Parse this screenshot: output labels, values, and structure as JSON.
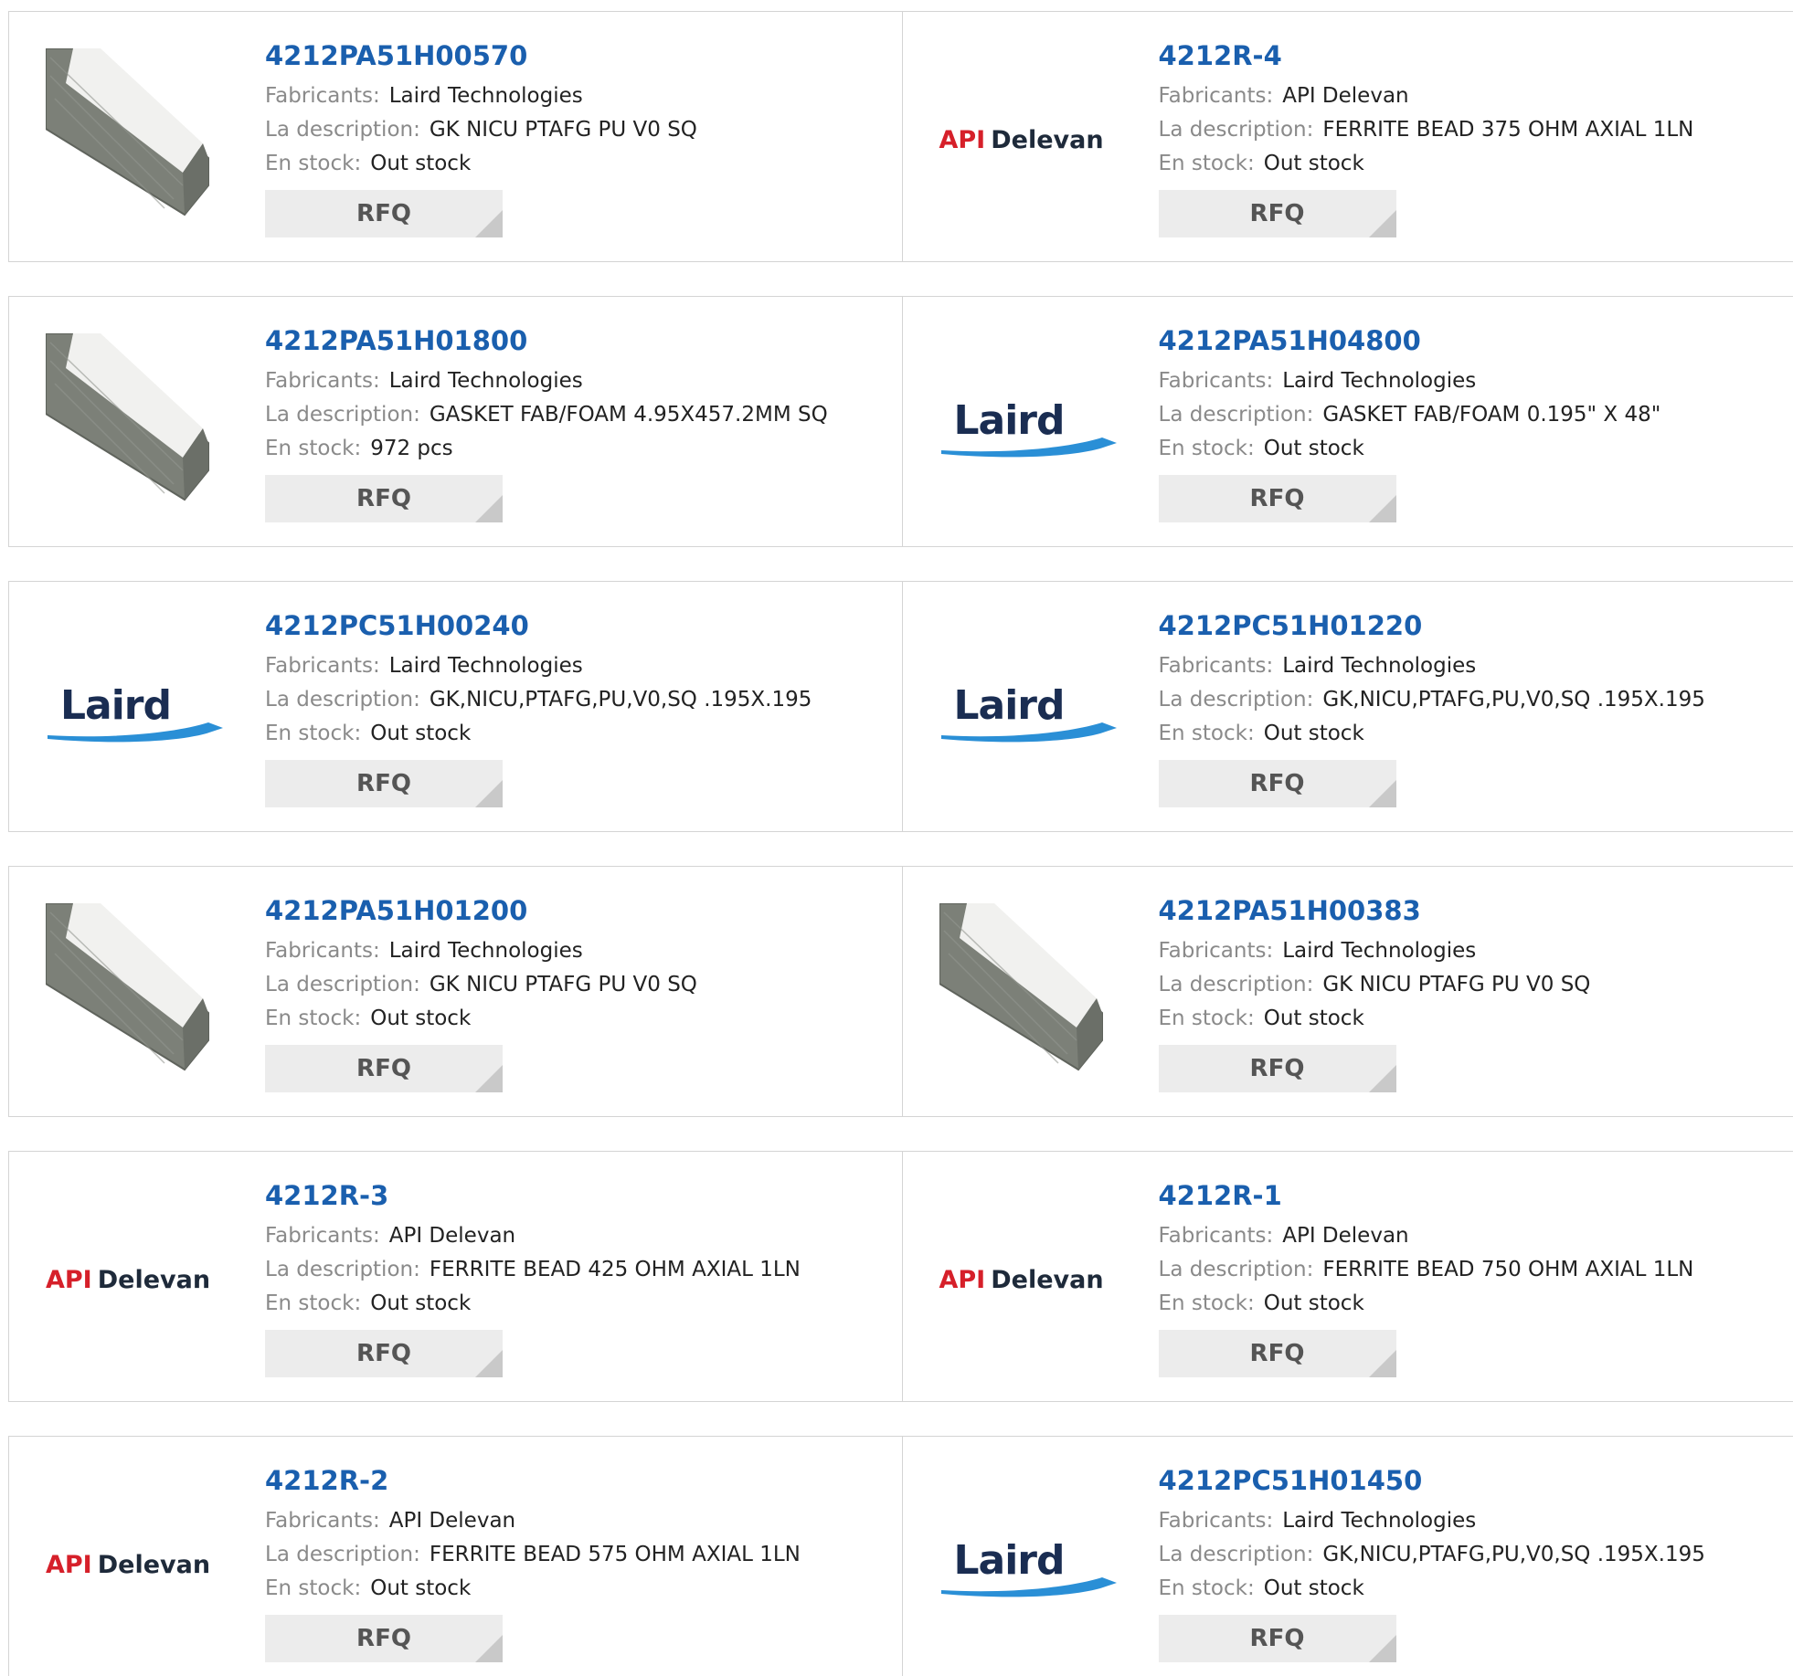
{
  "labels": {
    "manufacturer": "Fabricants:",
    "description": "La description:",
    "stock": "En stock:",
    "rfq": "RFQ"
  },
  "colors": {
    "part_link": "#1a5fae",
    "label": "#8a8a8a",
    "rfq_bg": "#ececec",
    "api_red": "#d6202a",
    "laird_navy": "#1a2d52",
    "laird_blue": "#2a8fd6"
  },
  "products": [
    {
      "part": "4212PA51H00570",
      "manufacturer": "Laird Technologies",
      "description": "GK NICU PTAFG PU V0 SQ",
      "stock": "Out stock",
      "image": "gasket-photo"
    },
    {
      "part": "4212R-4",
      "manufacturer": "API Delevan",
      "description": "FERRITE BEAD 375 OHM AXIAL 1LN",
      "stock": "Out stock",
      "image": "api-delevan-logo"
    },
    {
      "part": "4212PA51H01800",
      "manufacturer": "Laird Technologies",
      "description": "GASKET FAB/FOAM 4.95X457.2MM SQ",
      "stock": "972 pcs",
      "image": "gasket-photo"
    },
    {
      "part": "4212PA51H04800",
      "manufacturer": "Laird Technologies",
      "description": "GASKET FAB/FOAM 0.195\" X 48\"",
      "stock": "Out stock",
      "image": "laird-logo"
    },
    {
      "part": "4212PC51H00240",
      "manufacturer": "Laird Technologies",
      "description": "GK,NICU,PTAFG,PU,V0,SQ .195X.195",
      "stock": "Out stock",
      "image": "laird-logo"
    },
    {
      "part": "4212PC51H01220",
      "manufacturer": "Laird Technologies",
      "description": "GK,NICU,PTAFG,PU,V0,SQ .195X.195",
      "stock": "Out stock",
      "image": "laird-logo"
    },
    {
      "part": "4212PA51H01200",
      "manufacturer": "Laird Technologies",
      "description": "GK NICU PTAFG PU V0 SQ",
      "stock": "Out stock",
      "image": "gasket-photo"
    },
    {
      "part": "4212PA51H00383",
      "manufacturer": "Laird Technologies",
      "description": "GK NICU PTAFG PU V0 SQ",
      "stock": "Out stock",
      "image": "gasket-photo"
    },
    {
      "part": "4212R-3",
      "manufacturer": "API Delevan",
      "description": "FERRITE BEAD 425 OHM AXIAL 1LN",
      "stock": "Out stock",
      "image": "api-delevan-logo"
    },
    {
      "part": "4212R-1",
      "manufacturer": "API Delevan",
      "description": "FERRITE BEAD 750 OHM AXIAL 1LN",
      "stock": "Out stock",
      "image": "api-delevan-logo"
    },
    {
      "part": "4212R-2",
      "manufacturer": "API Delevan",
      "description": "FERRITE BEAD 575 OHM AXIAL 1LN",
      "stock": "Out stock",
      "image": "api-delevan-logo"
    },
    {
      "part": "4212PC51H01450",
      "manufacturer": "Laird Technologies",
      "description": "GK,NICU,PTAFG,PU,V0,SQ .195X.195",
      "stock": "Out stock",
      "image": "laird-logo"
    }
  ],
  "logos": {
    "api": "API",
    "delevan": "Delevan",
    "laird": "Laird"
  }
}
